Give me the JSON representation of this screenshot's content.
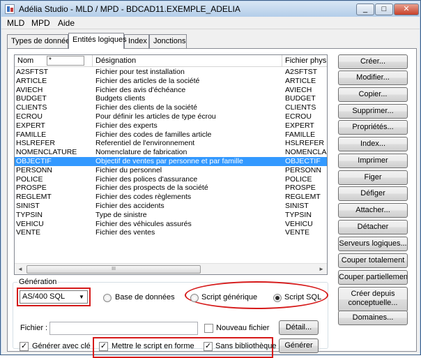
{
  "window": {
    "title": "Adélia Studio - MLD / MPD - BDCAD11.EXEMPLE_ADELIA"
  },
  "title_buttons": {
    "minimize": "_",
    "maximize": "□",
    "close": "✕"
  },
  "menu": [
    "MLD",
    "MPD",
    "Aide"
  ],
  "tabs": [
    "Types de donnée",
    "Entités logiques",
    "Index",
    "Jonctions"
  ],
  "list": {
    "headers": {
      "nom": "Nom",
      "filter": "*",
      "designation": "Désignation",
      "fichier": "Fichier physique"
    },
    "rows": [
      {
        "nom": "A2SFTST",
        "designation": "Fichier pour test installation",
        "fichier": "A2SFTST"
      },
      {
        "nom": "ARTICLE",
        "designation": "Fichier des articles de la société",
        "fichier": "ARTICLE"
      },
      {
        "nom": "AVIECH",
        "designation": "Fichier des avis d'échéance",
        "fichier": "AVIECH"
      },
      {
        "nom": "BUDGET",
        "designation": "Budgets clients",
        "fichier": "BUDGET"
      },
      {
        "nom": "CLIENTS",
        "designation": "Fichier des clients de la société",
        "fichier": "CLIENTS"
      },
      {
        "nom": "ECROU",
        "designation": "Pour définir les articles de type écrou",
        "fichier": "ECROU"
      },
      {
        "nom": "EXPERT",
        "designation": "Fichier des experts",
        "fichier": "EXPERT"
      },
      {
        "nom": "FAMILLE",
        "designation": "Fichier des codes de familles article",
        "fichier": "FAMILLE"
      },
      {
        "nom": "HSLREFER",
        "designation": "Referentiel de l'environnement",
        "fichier": "HSLREFER"
      },
      {
        "nom": "NOMENCLATURE",
        "designation": "Nomenclature de fabrication",
        "fichier": "NOMENCLA"
      },
      {
        "nom": "OBJECTIF",
        "designation": "Objectif de ventes par personne et par famille",
        "fichier": "OBJECTIF",
        "selected": true
      },
      {
        "nom": "PERSONN",
        "designation": "Fichier du personnel",
        "fichier": "PERSONN"
      },
      {
        "nom": "POLICE",
        "designation": "Fichier des polices d'assurance",
        "fichier": "POLICE"
      },
      {
        "nom": "PROSPE",
        "designation": "Fichier des prospects de la société",
        "fichier": "PROSPE"
      },
      {
        "nom": "REGLEMT",
        "designation": "Fichier des codes règlements",
        "fichier": "REGLEMT"
      },
      {
        "nom": "SINIST",
        "designation": "Fichier des accidents",
        "fichier": "SINIST"
      },
      {
        "nom": "TYPSIN",
        "designation": "Type de sinistre",
        "fichier": "TYPSIN"
      },
      {
        "nom": "VEHICU",
        "designation": "Fichier des véhicules assurés",
        "fichier": "VEHICU"
      },
      {
        "nom": "VENTE",
        "designation": "Fichier des ventes",
        "fichier": "VENTE"
      }
    ],
    "scroll_left": "◄",
    "scroll_right": "►",
    "scroll_grip": "III"
  },
  "side_buttons": [
    "Créer...",
    "Modifier...",
    "Copier...",
    "Supprimer...",
    "Propriétés...",
    "Index...",
    "Imprimer",
    "Figer",
    "Défiger",
    "Attacher...",
    "Détacher",
    "Serveurs logiques...",
    "Couper totalement",
    "Couper partiellement",
    "Créer depuis conceptuelle...",
    "Domaines..."
  ],
  "generation": {
    "title": "Génération",
    "combo_value": "AS/400 SQL",
    "combo_arrow": "▼",
    "radios": [
      {
        "label": "Base de données",
        "checked": false
      },
      {
        "label": "Script générique",
        "checked": false
      },
      {
        "label": "Script SQL",
        "checked": true
      }
    ],
    "fichier_label": "Fichier :",
    "fichier_value": "",
    "nouveau_fichier": {
      "label": "Nouveau fichier",
      "checked": false
    },
    "detail_button": "Détail...",
    "generer_avec_cle": {
      "label": "Générer avec clé",
      "checked": true
    },
    "mettre_en_forme": {
      "label": "Mettre le script en forme",
      "checked": true
    },
    "sans_bibliotheque": {
      "label": "Sans bibliothèque",
      "checked": true
    },
    "generer_button": "Générer"
  },
  "colors": {
    "selection": "#3399ff",
    "annotation": "#d61a1a",
    "title_gradient_top": "#d8e6f4"
  }
}
